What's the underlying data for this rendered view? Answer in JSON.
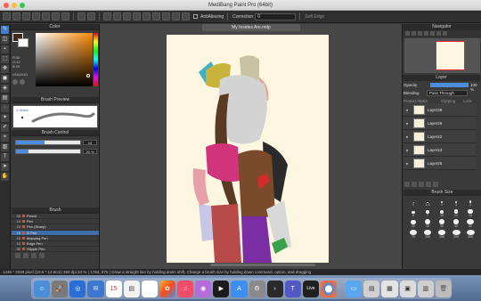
{
  "window": {
    "title": "MediBang Paint Pro (64bit)"
  },
  "toolbar": {
    "antialiasing_label": "AntiAliasing",
    "correction_label": "Correction",
    "correction_value": "0",
    "soft_edge_label": "Soft Edge"
  },
  "left_panel": {
    "color_title": "Color",
    "rgb": [
      "R:56",
      "G:42",
      "B:29"
    ],
    "hex": "#3A2A1D",
    "brush_preview_title": "Brush Preview",
    "brush_preview_size": "1.34mm",
    "brush_control_title": "Brush Control",
    "size_value": "19",
    "size_fraction": 0.45,
    "opacity_value": "20 %",
    "opacity_fraction": 0.2,
    "brush_title": "Brush",
    "brushes": [
      {
        "size": "30",
        "name": "Pencil"
      },
      {
        "size": "10",
        "name": "Pen"
      },
      {
        "size": "10",
        "name": "Pen (Sharp)"
      },
      {
        "size": "15",
        "name": "G Pen"
      },
      {
        "size": "15",
        "name": "Mapping Pen"
      },
      {
        "size": "10",
        "name": "Edge Pen"
      },
      {
        "size": "50",
        "name": "Stipple Pen"
      }
    ]
  },
  "document": {
    "tab_title": "My Insides Are.mdp"
  },
  "navigator": {
    "title": "Navigator"
  },
  "layer_panel": {
    "title": "Layer",
    "opacity_label": "Opacity",
    "opacity_value": "100 %",
    "blending_label": "Blending",
    "blending_value": "Pass Through",
    "protect_alpha_label": "Protect Alpha",
    "clipping_label": "Clipping",
    "lock_label": "Lock",
    "layers": [
      {
        "name": "Layer38"
      },
      {
        "name": "Layer26"
      },
      {
        "name": "Layer22"
      },
      {
        "name": "Layer23"
      },
      {
        "name": "Layer25"
      }
    ]
  },
  "brush_size_panel": {
    "title": "Brush Size",
    "sizes": [
      "1",
      "1.5",
      "2",
      "3",
      "4",
      "5",
      "7",
      "10",
      "12",
      "15",
      "20",
      "25",
      "30",
      "40",
      "50",
      "70",
      "100",
      "150",
      "200",
      "300"
    ]
  },
  "statusbar": {
    "text": "1446 * 2039 pixel   (10.5 * 14.8cm)   350 dpi   33 %   ( 1784, 875 )   Draw a straight line by holding down shift, Change a brush size by holding down command, option, and dragging"
  },
  "dock": {
    "calendar_day": "15",
    "live_label": "Live"
  }
}
